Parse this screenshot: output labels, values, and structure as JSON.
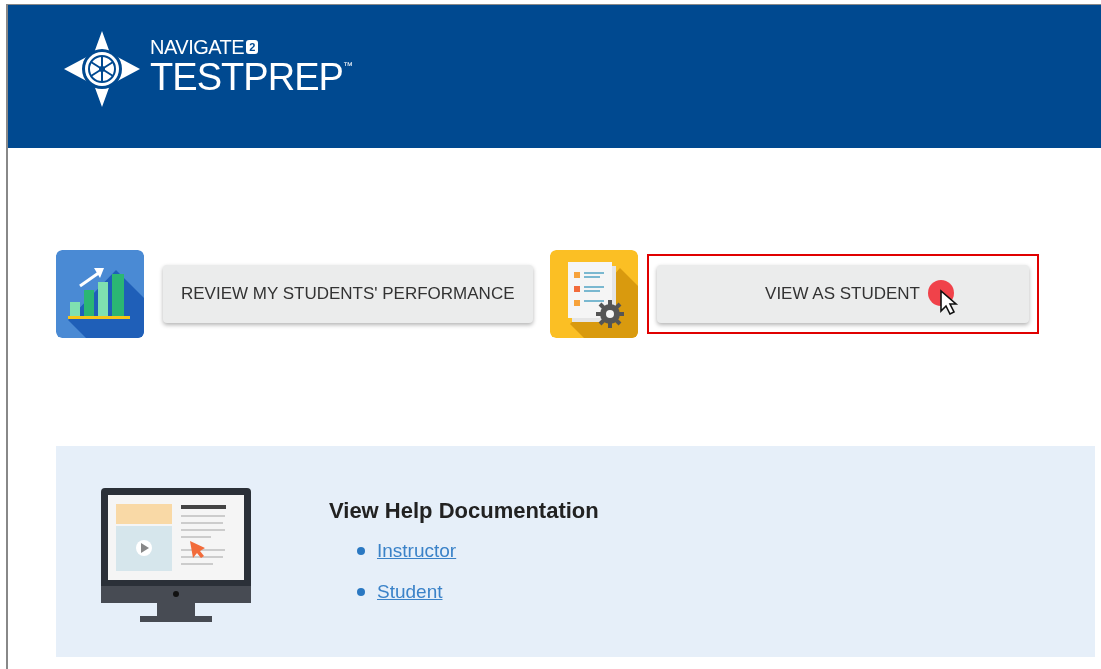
{
  "header": {
    "logo": {
      "line1": "NAVIGATE",
      "badge": "2",
      "line2": "TESTPREP",
      "trademark": "™"
    }
  },
  "actions": [
    {
      "kind": "chart",
      "label": "REVIEW MY STUDENTS' PERFORMANCE",
      "highlighted": false
    },
    {
      "kind": "settings",
      "label": "VIEW AS STUDENT",
      "highlighted": true
    }
  ],
  "help": {
    "title": "View Help Documentation",
    "links": [
      "Instructor",
      "Student"
    ]
  }
}
